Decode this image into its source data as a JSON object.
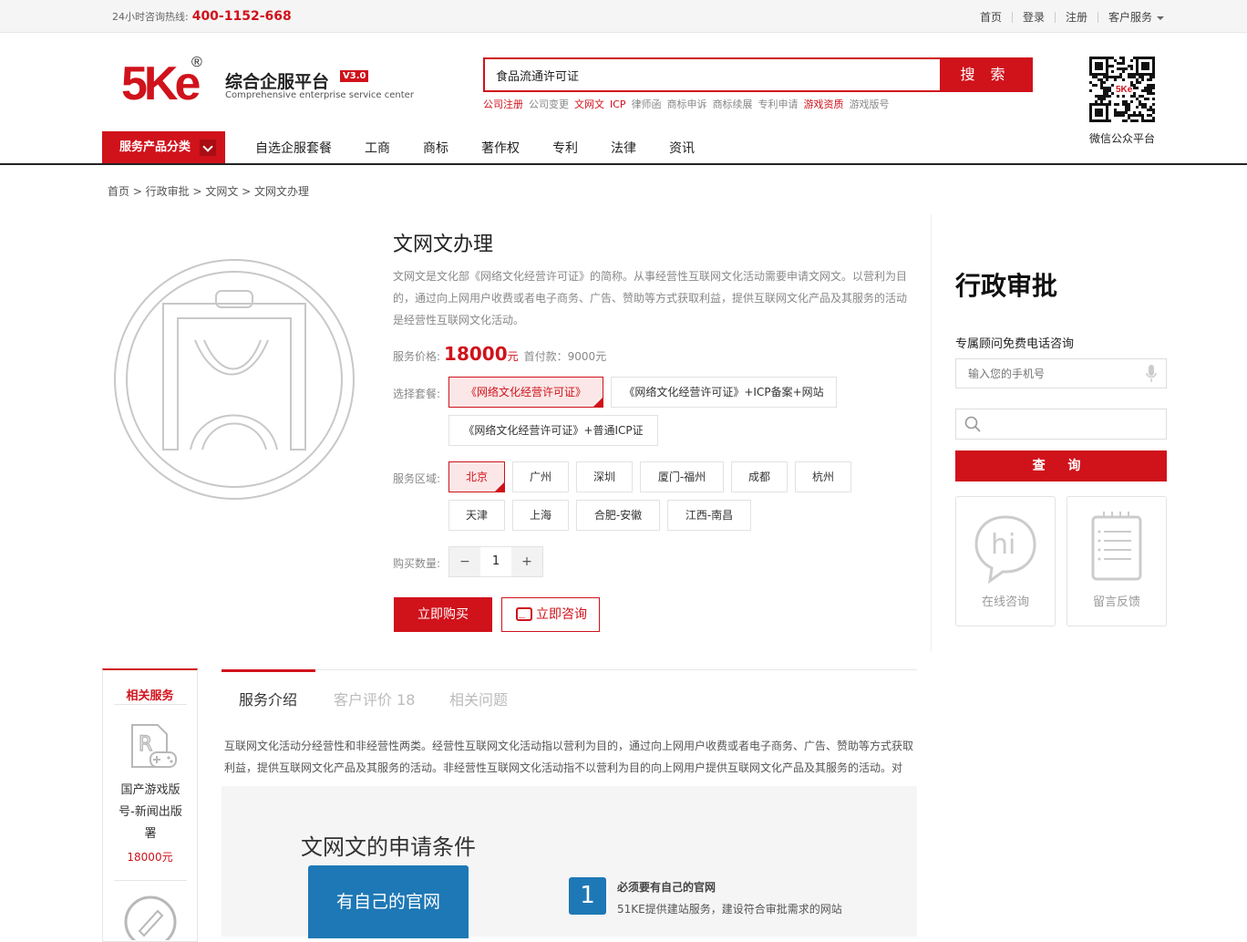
{
  "topbar": {
    "hotline_label": "24小时咨询热线:",
    "hotline_number": "400-1152-668",
    "links": [
      "首页",
      "登录",
      "注册"
    ],
    "customer_service": "客户服务"
  },
  "header": {
    "logo_text": "5Ke",
    "logo_registered": "®",
    "title": "综合企服平台",
    "version": "V3.0",
    "subtitle": "Comprehensive enterprise service center",
    "search_value": "食品流通许可证",
    "search_button": "搜 索",
    "hot_words": [
      {
        "text": "公司注册",
        "highlight": true
      },
      {
        "text": "公司变更",
        "highlight": false
      },
      {
        "text": "文网文",
        "highlight": true
      },
      {
        "text": "ICP",
        "highlight": true
      },
      {
        "text": "律师函",
        "highlight": false
      },
      {
        "text": "商标申诉",
        "highlight": false
      },
      {
        "text": "商标续展",
        "highlight": false
      },
      {
        "text": "专利申请",
        "highlight": false
      },
      {
        "text": "游戏资质",
        "highlight": true
      },
      {
        "text": "游戏版号",
        "highlight": false
      }
    ],
    "qr_label": "微信公众平台"
  },
  "nav": {
    "category_label": "服务产品分类",
    "items": [
      "自选企服套餐",
      "工商",
      "商标",
      "著作权",
      "专利",
      "法律",
      "资讯"
    ]
  },
  "breadcrumb": "首页 > 行政审批 > 文网文 > 文网文办理",
  "product": {
    "title": "文网文办理",
    "description": "文网文是文化部《网络文化经营许可证》的简称。从事经营性互联网文化活动需要申请文网文。以营利为目的，通过向上网用户收费或者电子商务、广告、赞助等方式获取利益，提供互联网文化产品及其服务的活动是经营性互联网文化活动。",
    "price_label": "服务价格:",
    "price": "18000",
    "price_unit": "元",
    "down_payment": "首付款：9000元",
    "package_label": "选择套餐:",
    "packages": [
      "《网络文化经营许可证》",
      "《网络文化经营许可证》+ICP备案+网站",
      "《网络文化经营许可证》+普通ICP证"
    ],
    "region_label": "服务区域:",
    "regions": [
      "北京",
      "广州",
      "深圳",
      "厦门-福州",
      "成都",
      "杭州",
      "天津",
      "上海",
      "合肥-安徽",
      "江西-南昌"
    ],
    "quantity_label": "购买数量:",
    "quantity": "1",
    "minus": "−",
    "plus": "+",
    "buy_button": "立即购买",
    "consult_button": "立即咨询"
  },
  "sidebar": {
    "title": "行政审批",
    "phone_label": "专属顾问免费电话咨询",
    "phone_placeholder": "输入您的手机号",
    "query_button": "查 询",
    "online_label": "在线咨询",
    "feedback_label": "留言反馈"
  },
  "related": {
    "title": "相关服务",
    "item_name": "国产游戏版号-新闻出版署",
    "item_price": "18000元"
  },
  "tabs": {
    "items": [
      "服务介绍",
      "客户评价 18",
      "相关问题"
    ]
  },
  "intro": "互联网文化活动分经营性和非经营性两类。经营性互联网文化活动指以营利为目的，通过向上网用户收费或者电子商务、广告、赞助等方式获取利益，提供互联网文化产品及其服务的活动。非经营性互联网文化活动指不以营利为目的向上网用户提供互联网文化产品及其服务的活动。对",
  "conditions": {
    "title": "文网文的申请条件",
    "box_text": "有自己的官网",
    "step_number": "1",
    "step_title": "必须要有自己的官网",
    "step_text": "51KE提供建站服务，建设符合审批需求的网站"
  },
  "colors": {
    "brand": "#d0121b",
    "info_blue": "#1e78b5"
  }
}
